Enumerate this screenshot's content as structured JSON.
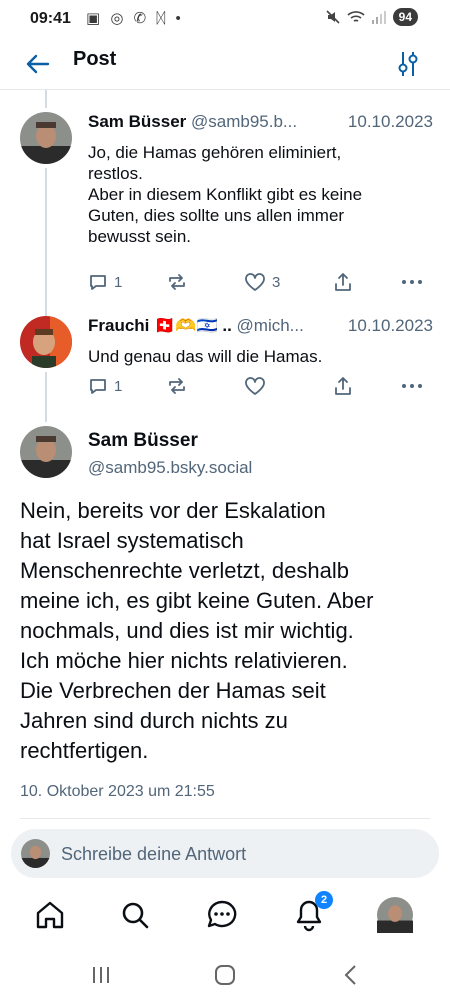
{
  "status_bar": {
    "time": "09:41",
    "notification_icons": "▣ ◎ ✆ ᛞ •",
    "battery": "94"
  },
  "header": {
    "title": "Post"
  },
  "replies": [
    {
      "author": "Sam Büsser",
      "handle": "@samb95.b...",
      "date": "10.10.2023",
      "text_lines": [
        "Jo, die Hamas gehören eliminiert,",
        "restlos.",
        "Aber in diesem Konflikt gibt es keine",
        "Guten, dies sollte uns allen immer",
        "bewusst sein."
      ],
      "reply_count": "1",
      "like_count": "3"
    },
    {
      "author": "Frauchi 🇨🇭🫶🇮🇱 ..",
      "handle": "@mich...",
      "date": "10.10.2023",
      "text_lines": [
        "Und genau das will die Hamas."
      ],
      "reply_count": "1",
      "like_count": ""
    }
  ],
  "main_post": {
    "author": "Sam Büsser",
    "handle": "@samb95.bsky.social",
    "text_lines": [
      "Nein, bereits vor der Eskalation",
      "hat Israel systematisch",
      "Menschenrechte verletzt, deshalb",
      "meine ich, es gibt keine Guten. Aber",
      "nochmals, und dies ist mir wichtig.",
      "Ich möche hier nichts relativieren.",
      "Die Verbrechen der Hamas seit",
      "Jahren sind durch nichts zu",
      "rechtfertigen."
    ],
    "timestamp": "10. Oktober 2023 um 21:55"
  },
  "reply_box": {
    "placeholder": "Schreibe deine Antwort"
  },
  "bottom_nav": {
    "items": [
      "home-icon",
      "search-icon",
      "chat-icon",
      "notifications-icon",
      "profile-avatar"
    ],
    "notifications_badge": "2"
  },
  "colors": {
    "accent": "#1083fe",
    "muted_text": "#52667a",
    "thread_line": "#d4dbe2",
    "header_icon": "#0b5fa5"
  }
}
